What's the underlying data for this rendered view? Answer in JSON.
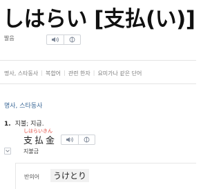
{
  "entry": {
    "headword": "しはらい [支払(い)]"
  },
  "pronunciation": {
    "label": "발음",
    "play_icon": "speaker-icon",
    "slow_icon": "slow-play-icon"
  },
  "tabs": [
    {
      "label": "명사, 스타동사"
    },
    {
      "label": "복합어"
    },
    {
      "label": "관련 한자"
    },
    {
      "label": "요미가나 같은 단어"
    }
  ],
  "tab_separator": "|",
  "definition": {
    "part_of_speech": "명사, 스타동사",
    "sense_number": "1.",
    "sense_text": "지불; 지급."
  },
  "example": {
    "furigana": "しはらいきん",
    "word": "支払金",
    "meaning": "지불금",
    "toggle_icon": "chevron-down-icon"
  },
  "antonym": {
    "label": "반의어",
    "word": "うけとり"
  },
  "colors": {
    "heading": "#3d6a98",
    "furigana": "#e2473d",
    "icon": "#7b8595"
  }
}
